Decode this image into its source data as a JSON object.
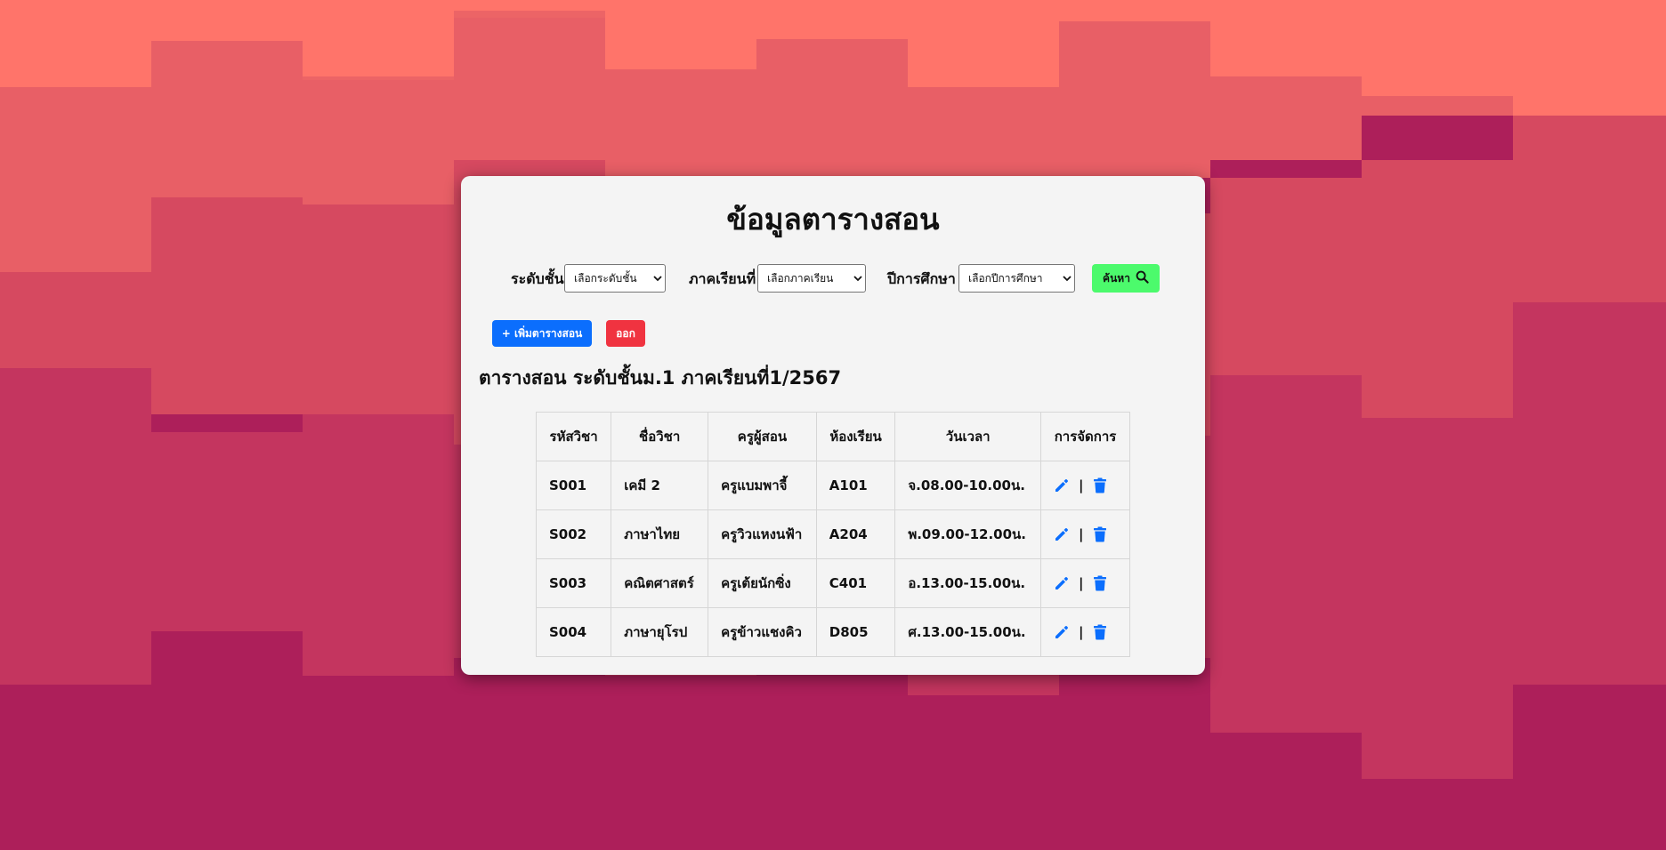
{
  "page": {
    "title": "ข้อมูลตารางสอน",
    "subtitle": "ตารางสอน ระดับชั้นม.1 ภาคเรียนที่1/2567"
  },
  "filters": {
    "level": {
      "label": "ระดับชั้น",
      "selected": "เลือกระดับชั้น"
    },
    "semester": {
      "label": "ภาคเรียนที่",
      "selected": "เลือกภาคเรียน"
    },
    "year": {
      "label": "ปีการศึกษา",
      "selected": "เลือกปีการศึกษา"
    },
    "search_label": "ค้นหา"
  },
  "actions": {
    "add_label": "+ เพิ่มตารางสอน",
    "exit_label": "ออก"
  },
  "table": {
    "headers": [
      "รหัสวิชา",
      "ชื่อวิชา",
      "ครูผู้สอน",
      "ห้องเรียน",
      "วันเวลา",
      "การจัดการ"
    ],
    "separator": "|",
    "rows": [
      [
        "S001",
        "เคมี 2",
        "ครูแบมพาจี้",
        "A101",
        "จ.08.00-10.00น."
      ],
      [
        "S002",
        "ภาษาไทย",
        "ครูวิวแหงนฟ้า",
        "A204",
        "พ.09.00-12.00น."
      ],
      [
        "S003",
        "คณิตศาสตร์",
        "ครูเต้ยนักซิ่ง",
        "C401",
        "อ.13.00-15.00น."
      ],
      [
        "S004",
        "ภาษายุโรป",
        "ครูข้าวแชงคิว",
        "D805",
        "ศ.13.00-15.00น."
      ]
    ]
  },
  "icons": {
    "search": "search-icon",
    "edit": "pencil-icon",
    "delete": "trash-icon",
    "dropdown": "chevron-down-icon"
  },
  "colors": {
    "card_background": "#f4f4f4",
    "search_button": "#4cfa6c",
    "add_button": "#0b6efd",
    "exit_button": "#f03340",
    "icon_blue": "#0b6efd"
  }
}
